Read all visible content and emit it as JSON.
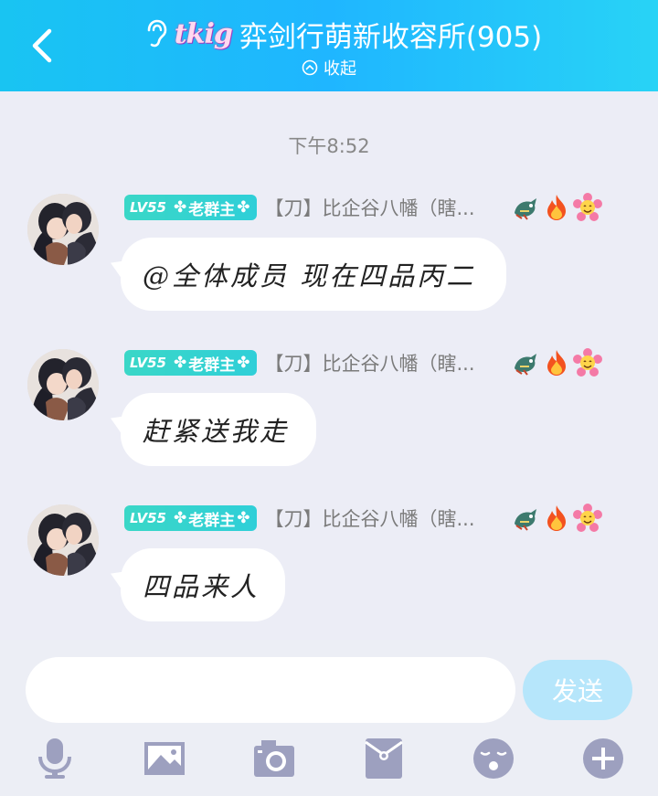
{
  "header": {
    "title_logo": "tkig",
    "title": "弈剑行萌新收容所(905)",
    "collapse_label": "收起",
    "colors": {
      "bg_start": "#19c4f2",
      "bg_end": "#28d3f6"
    }
  },
  "timestamp": "下午8:52",
  "messages": [
    {
      "badge_level": "LV55",
      "badge_role": "老群主",
      "nickname": "【刀】比企谷八幡（瞎...",
      "text": "@全体成员 现在四品丙二"
    },
    {
      "badge_level": "LV55",
      "badge_role": "老群主",
      "nickname": "【刀】比企谷八幡（瞎...",
      "text": "赶紧送我走"
    },
    {
      "badge_level": "LV55",
      "badge_role": "老群主",
      "nickname": "【刀】比企谷八幡（瞎...",
      "text": "四品来人"
    }
  ],
  "input": {
    "placeholder": "",
    "value": ""
  },
  "send_label": "发送",
  "toolbar_icons": [
    "microphone-icon",
    "image-icon",
    "camera-icon",
    "red-packet-icon",
    "emoji-icon",
    "plus-icon"
  ]
}
